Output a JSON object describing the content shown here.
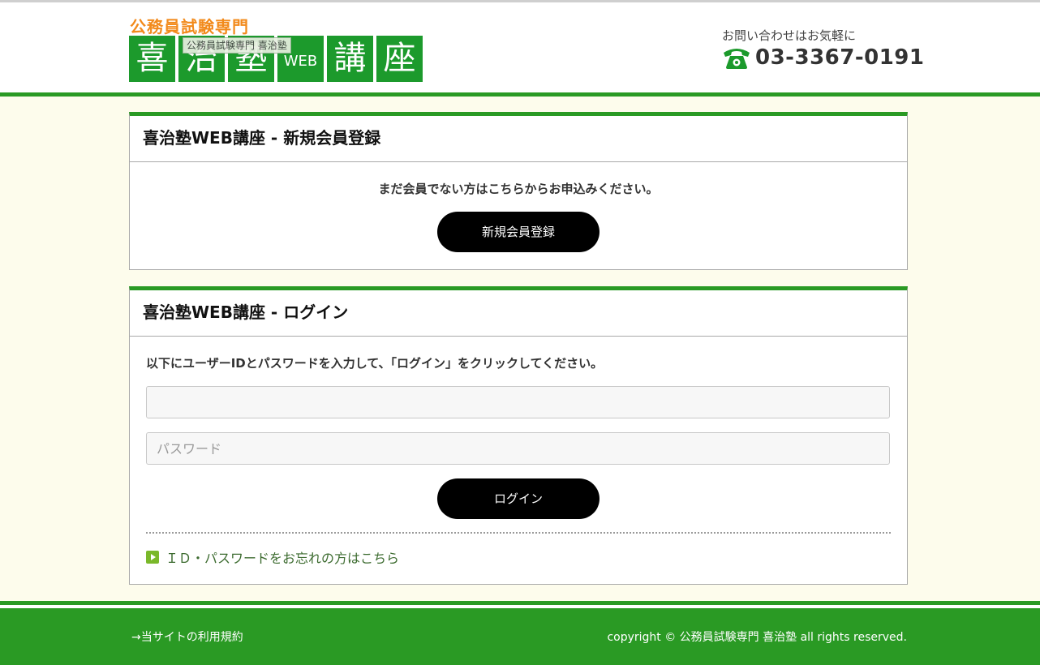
{
  "header": {
    "logo_tag": "公務員試験専門",
    "logo_chars": [
      "喜",
      "治",
      "塾"
    ],
    "logo_web": "WEB",
    "logo_chars2": [
      "講",
      "座"
    ],
    "logo_tooltip": "公務員試験専門 喜治塾",
    "contact_label": "お問い合わせはお気軽に",
    "phone_icon": "telephone-icon",
    "phone_number": "03-3367-0191"
  },
  "register_panel": {
    "title": "喜治塾WEB講座 - 新規会員登録",
    "message": "まだ会員でない方はこちらからお申込みください。",
    "button_label": "新規会員登録"
  },
  "login_panel": {
    "title": "喜治塾WEB講座 - ログイン",
    "instruction": "以下にユーザーIDとパスワードを入力して、「ログイン」をクリックしてください。",
    "user_id_value": "",
    "password_placeholder": "パスワード",
    "button_label": "ログイン",
    "forgot_icon": "arrow-right-icon",
    "forgot_link": "ＩＤ・パスワードをお忘れの方はこちら"
  },
  "footer": {
    "terms_link": "→当サイトの利用規約",
    "copyright": "copyright © 公務員試験専門 喜治塾 all rights reserved."
  },
  "colors": {
    "brand_green": "#2a9a24",
    "logo_orange": "#f28a1b",
    "background": "#fdfcec",
    "button_black": "#000000"
  }
}
